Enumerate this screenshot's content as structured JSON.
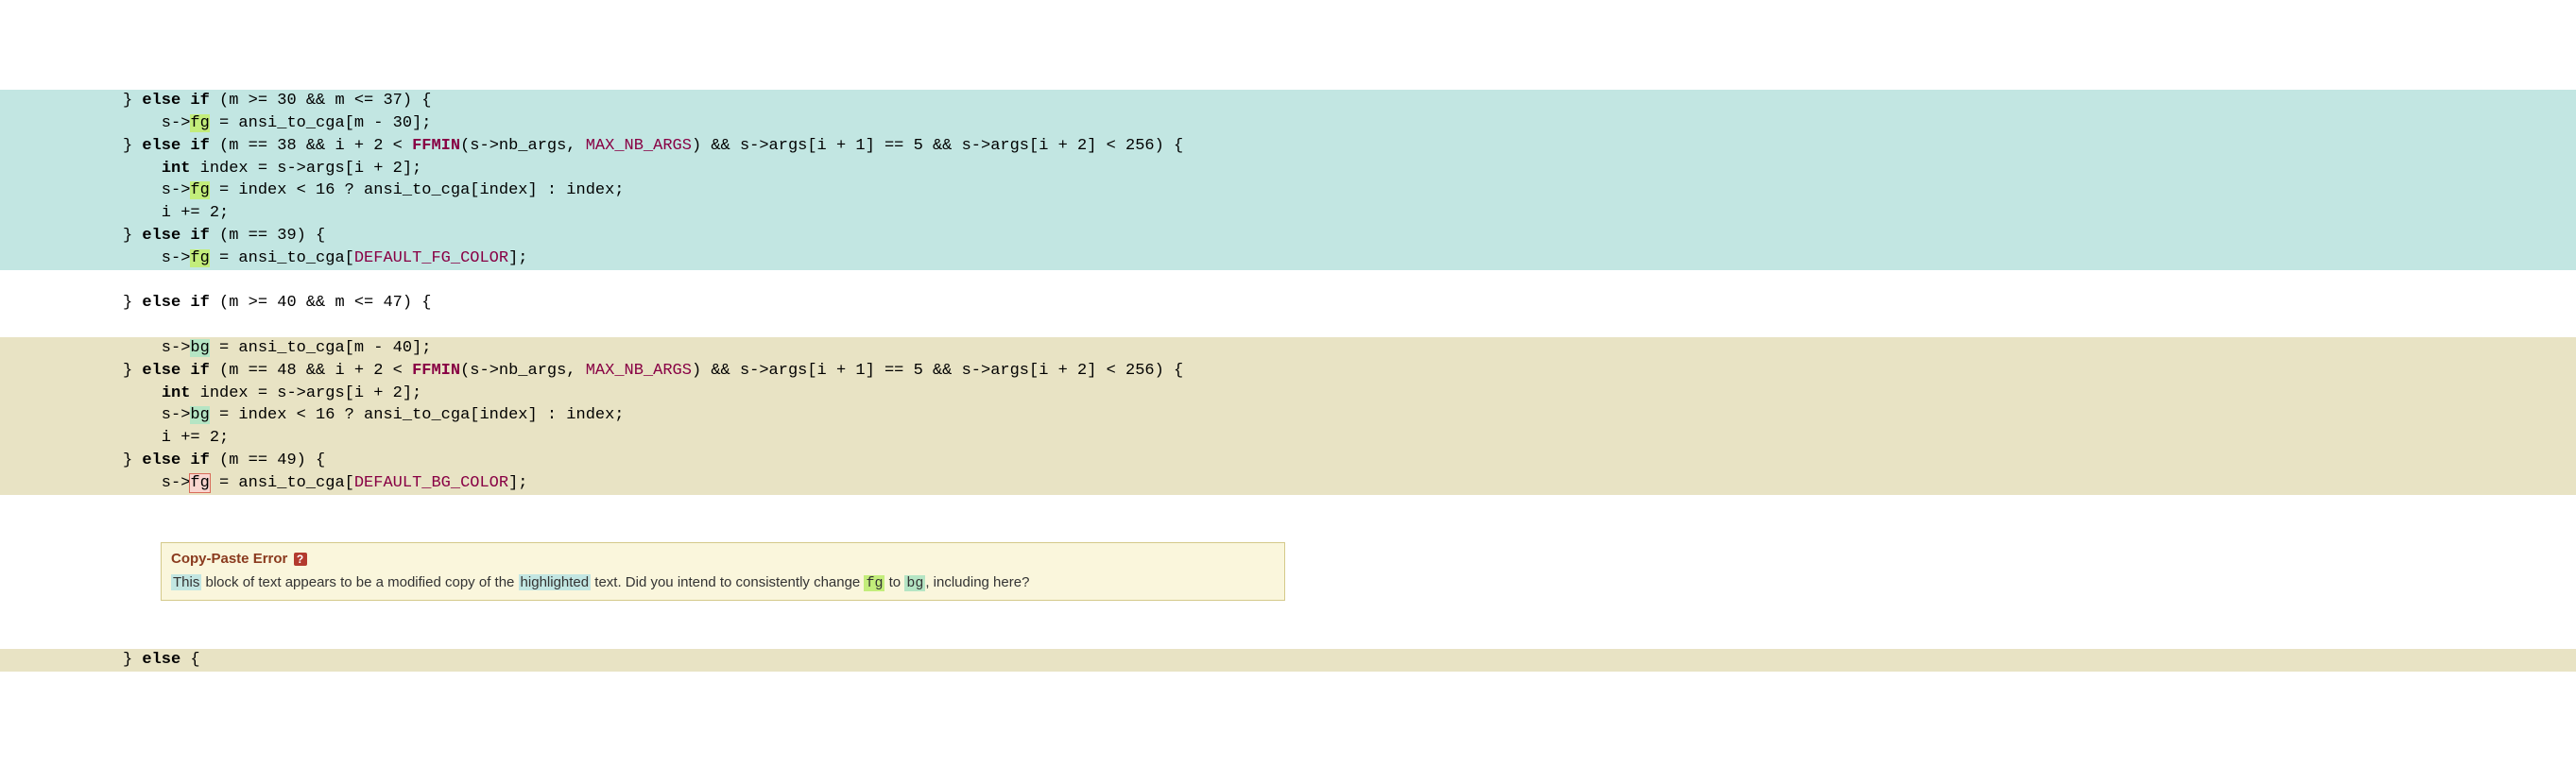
{
  "code": {
    "cyan": [
      {
        "indent": "} ",
        "kw": "else if",
        "rest": " (m >= 30 && m <= 37) {"
      },
      {
        "indent": "    s->",
        "hl": "fg",
        "hlClass": "hl-fg",
        "rest": " = ansi_to_cga[m - 30];"
      },
      {
        "indent": "} ",
        "kw": "else if",
        "mid": " (m == 38 && i + 2 < ",
        "fn": "FFMIN",
        "args": "(s->nb_args, ",
        "const": "MAX_NB_ARGS",
        "tail": ") && s->args[i + 1] == 5 && s->args[i + 2] < 256) {"
      },
      {
        "indent": "    ",
        "kw": "int",
        "rest": " index = s->args[i + 2];"
      },
      {
        "indent": "    s->",
        "hl": "fg",
        "hlClass": "hl-fg",
        "rest": " = index < 16 ? ansi_to_cga[index] : index;"
      },
      {
        "indent": "    i += 2;"
      },
      {
        "indent": "} ",
        "kw": "else if",
        "rest": " (m == 39) {"
      },
      {
        "indent": "    s->",
        "hl": "fg",
        "hlClass": "hl-fg",
        "mid": " = ansi_to_cga[",
        "const": "DEFAULT_FG_COLOR",
        "tail": "];"
      }
    ],
    "white": [
      {
        "indent": "} ",
        "kw": "else if",
        "rest": " (m >= 40 && m <= 47) {"
      }
    ],
    "tan": [
      {
        "indent": "    s->",
        "hl": "bg",
        "hlClass": "hl-bg",
        "rest": " = ansi_to_cga[m - 40];"
      },
      {
        "indent": "} ",
        "kw": "else if",
        "mid": " (m == 48 && i + 2 < ",
        "fn": "FFMIN",
        "args": "(s->nb_args, ",
        "const": "MAX_NB_ARGS",
        "tail": ") && s->args[i + 1] == 5 && s->args[i + 2] < 256) {"
      },
      {
        "indent": "    ",
        "kw": "int",
        "rest": " index = s->args[i + 2];"
      },
      {
        "indent": "    s->",
        "hl": "bg",
        "hlClass": "hl-bg",
        "rest": " = index < 16 ? ansi_to_cga[index] : index;"
      },
      {
        "indent": "    i += 2;"
      },
      {
        "indent": "} ",
        "kw": "else if",
        "rest": " (m == 49) {"
      },
      {
        "indent": "    s->",
        "hl": "fg",
        "hlClass": "hl-err",
        "mid": " = ansi_to_cga[",
        "const": "DEFAULT_BG_COLOR",
        "tail": "];"
      }
    ],
    "tanAfter": [
      {
        "indent": "} ",
        "kw": "else",
        "rest": " {"
      }
    ]
  },
  "note": {
    "title": "Copy-Paste Error",
    "help": "?",
    "body_parts": {
      "p1": "This",
      "p2": " block of text appears to be a modified copy of the ",
      "p3": "highlighted",
      "p4": " text.  Did you intend to consistently change ",
      "p5": "fg",
      "p6": " to ",
      "p7": "bg",
      "p8": ", including here?"
    }
  }
}
